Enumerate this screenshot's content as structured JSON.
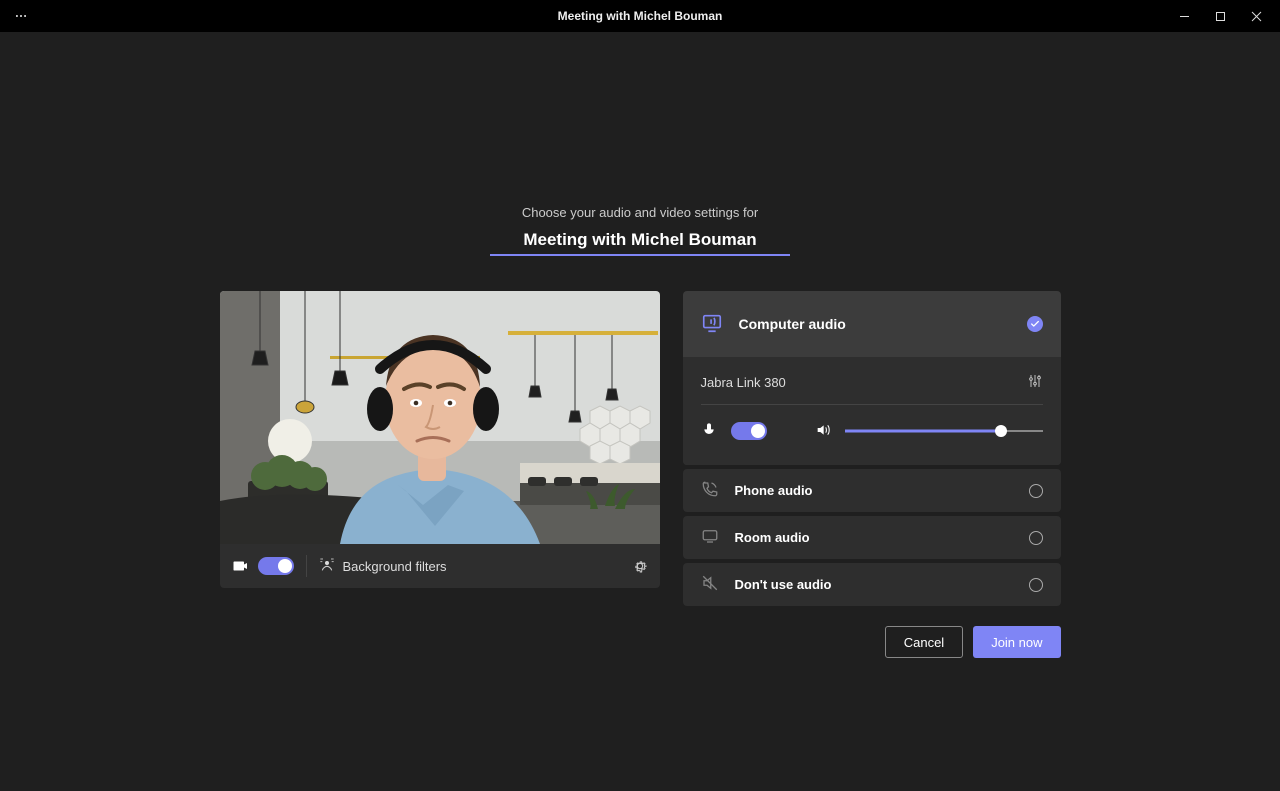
{
  "window": {
    "title": "Meeting with Michel Bouman"
  },
  "header": {
    "subtitle": "Choose your audio and video settings for",
    "meeting_name": "Meeting with Michel Bouman"
  },
  "video_bar": {
    "filters_label": "Background filters"
  },
  "audio": {
    "computer_audio_label": "Computer audio",
    "device_name": "Jabra Link 380",
    "phone_audio_label": "Phone audio",
    "room_audio_label": "Room audio",
    "dont_use_audio_label": "Don't use audio",
    "volume_percent": 79
  },
  "actions": {
    "cancel_label": "Cancel",
    "join_label": "Join now"
  }
}
